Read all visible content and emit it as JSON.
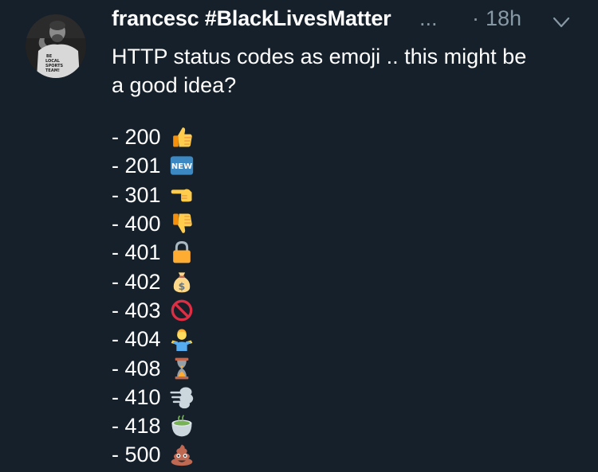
{
  "tweet": {
    "display_name": "francesc #BlackLivesMatter",
    "ellipsis": "...",
    "separator": "·",
    "timestamp": "18h",
    "avatar_shirt_text": [
      "BE",
      "LOCAL",
      "SPORTS",
      "TEAM!"
    ],
    "text_lines": [
      "HTTP status codes as emoji .. this might be",
      "a good idea?"
    ],
    "codes": [
      {
        "label": "- 200",
        "emoji": "thumbs-up"
      },
      {
        "label": "- 201",
        "emoji": "new-button",
        "emoji_text": "NEW"
      },
      {
        "label": "- 301",
        "emoji": "backhand-index-pointing-left"
      },
      {
        "label": "- 400",
        "emoji": "thumbs-down"
      },
      {
        "label": "- 401",
        "emoji": "locked"
      },
      {
        "label": "- 402",
        "emoji": "money-bag"
      },
      {
        "label": "- 403",
        "emoji": "prohibited"
      },
      {
        "label": "- 404",
        "emoji": "person-shrugging"
      },
      {
        "label": "- 408",
        "emoji": "hourglass-done"
      },
      {
        "label": "- 410",
        "emoji": "dashing-away"
      },
      {
        "label": "- 418",
        "emoji": "teacup-without-handle"
      },
      {
        "label": "- 500",
        "emoji": "pile-of-poo"
      }
    ]
  },
  "colors": {
    "background": "#15202b",
    "text": "#ffffff",
    "muted": "#8899a6"
  }
}
